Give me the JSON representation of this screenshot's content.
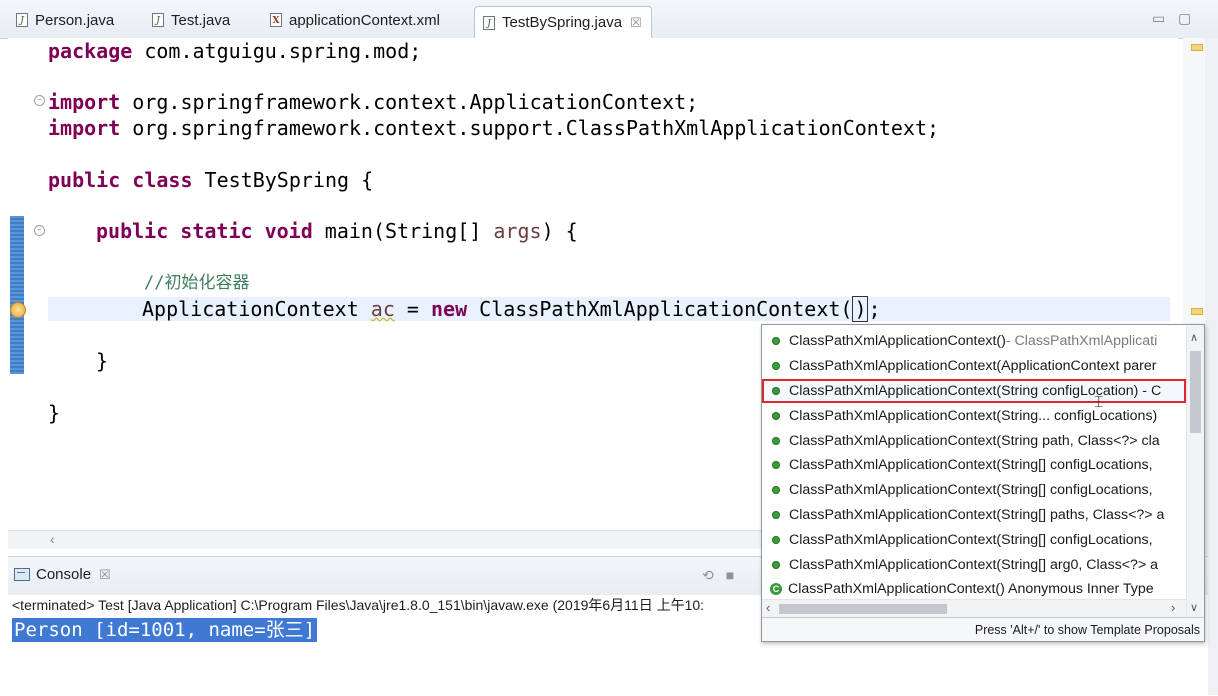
{
  "tabs": [
    {
      "label": "Person.java",
      "icon": "java-file-icon"
    },
    {
      "label": "Test.java",
      "icon": "java-file-icon"
    },
    {
      "label": "applicationContext.xml",
      "icon": "xml-file-icon"
    },
    {
      "label": "TestBySpring.java",
      "icon": "java-file-icon",
      "active": true,
      "close": "☒"
    }
  ],
  "window": {
    "minimize": "▭",
    "maximize": "▢"
  },
  "code": {
    "line1": {
      "kw": "package",
      "rest": " com.atguigu.spring.mod;"
    },
    "line2": {
      "kw": "import",
      "rest": " org.springframework.context.ApplicationContext;"
    },
    "line3": {
      "kw": "import",
      "rest": " org.springframework.context.support.ClassPathXmlApplicationContext;"
    },
    "line4": {
      "kw1": "public",
      "kw2": "class",
      "rest": " TestBySpring {"
    },
    "line5": {
      "kw1": "public",
      "kw2": "static",
      "kw3": "void",
      "pre": " main(String[] ",
      "param": "args",
      "post": ") {"
    },
    "line6": {
      "comment": "//初始化容器"
    },
    "line7": {
      "pre": "ApplicationContext ",
      "var": "ac",
      "mid": " = ",
      "kw": "new",
      "post": " ClassPathXmlApplicationContext(",
      "cursor": ")",
      "end": ";"
    },
    "line8": {
      "text": "}"
    },
    "line9": {
      "text": "}"
    }
  },
  "console": {
    "tab_label": "Console",
    "tab_close": "☒",
    "terminated": "<terminated> Test [Java Application] C:\\Program Files\\Java\\jre1.8.0_151\\bin\\javaw.exe (2019年6月11日 上午10:",
    "output": "Person [id=1001, name=张三]"
  },
  "assist": {
    "items": [
      {
        "text": "ClassPathXmlApplicationContext()",
        "desc": " - ClassPathXmlApplicati"
      },
      {
        "text": "ClassPathXmlApplicationContext(ApplicationContext parer",
        "desc": ""
      },
      {
        "text": "ClassPathXmlApplicationContext(String configLocation) - C",
        "desc": "",
        "selected": true
      },
      {
        "text": "ClassPathXmlApplicationContext(String... configLocations)",
        "desc": ""
      },
      {
        "text": "ClassPathXmlApplicationContext(String path, Class<?> cla",
        "desc": ""
      },
      {
        "text": "ClassPathXmlApplicationContext(String[] configLocations,",
        "desc": ""
      },
      {
        "text": "ClassPathXmlApplicationContext(String[] configLocations,",
        "desc": ""
      },
      {
        "text": "ClassPathXmlApplicationContext(String[] paths, Class<?> a",
        "desc": ""
      },
      {
        "text": "ClassPathXmlApplicationContext(String[] configLocations,",
        "desc": ""
      },
      {
        "text": "ClassPathXmlApplicationContext(String[] arg0, Class<?> a",
        "desc": ""
      },
      {
        "text": "ClassPathXmlApplicationContext()  Anonymous Inner Type",
        "desc": "",
        "icon": "anonymous-class-icon",
        "icon_glyph": "C"
      }
    ],
    "footer": "Press 'Alt+/' to show Template Proposals"
  },
  "colors": {
    "keyword": "#7f0055",
    "comment": "#3f7f5f",
    "selection": "#3f79d4",
    "highlight_border": "#e0272d"
  }
}
